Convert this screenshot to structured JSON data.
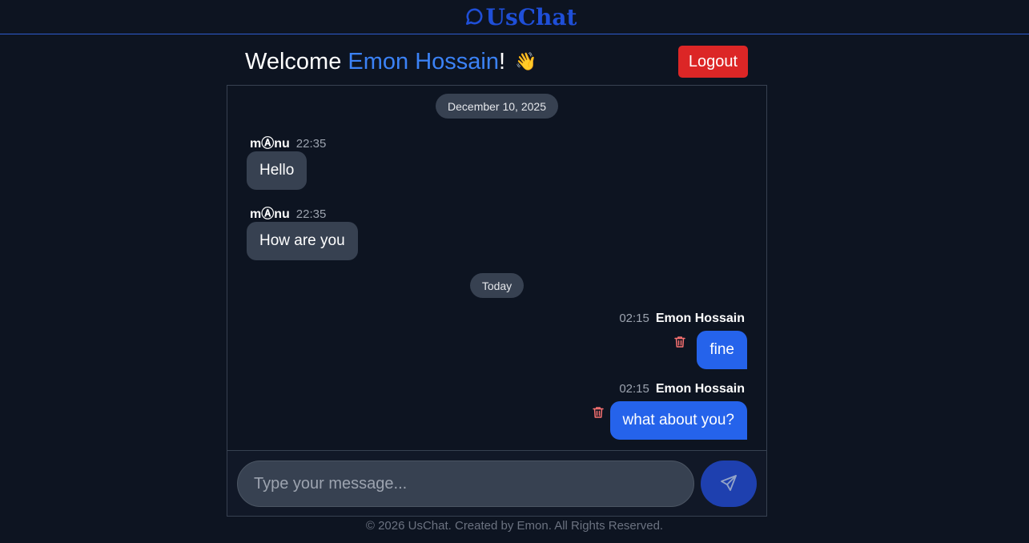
{
  "app": {
    "brand_name": "UsChat",
    "brand_icon": "chat-bubble-icon",
    "brand_color": "#1f4fd8"
  },
  "header": {
    "welcome_prefix": "Welcome ",
    "user_name": "Emon Hossain",
    "welcome_suffix": "!",
    "wave_emoji": "👋",
    "logout_label": "Logout"
  },
  "chat": {
    "date_separators": [
      "December 10, 2025",
      "Today"
    ],
    "messages": [
      {
        "sender": "mⒶnu",
        "time": "22:35",
        "text": "Hello",
        "own": false
      },
      {
        "sender": "mⒶnu",
        "time": "22:35",
        "text": "How are you",
        "own": false
      },
      {
        "sender": "Emon Hossain",
        "time": "02:15",
        "text": "fine",
        "own": true
      },
      {
        "sender": "Emon Hossain",
        "time": "02:15",
        "text": "what about you?",
        "own": true
      }
    ]
  },
  "composer": {
    "placeholder": "Type your message...",
    "value": "",
    "send_icon": "send-icon"
  },
  "footer": {
    "text": "© 2026 UsChat. Created by Emon. All Rights Reserved."
  },
  "colors": {
    "background": "#0d1421",
    "own_bubble": "#2563eb",
    "other_bubble": "#374151",
    "logout": "#dc2626",
    "accent_name": "#3b82f6",
    "delete_icon": "#f87171"
  }
}
